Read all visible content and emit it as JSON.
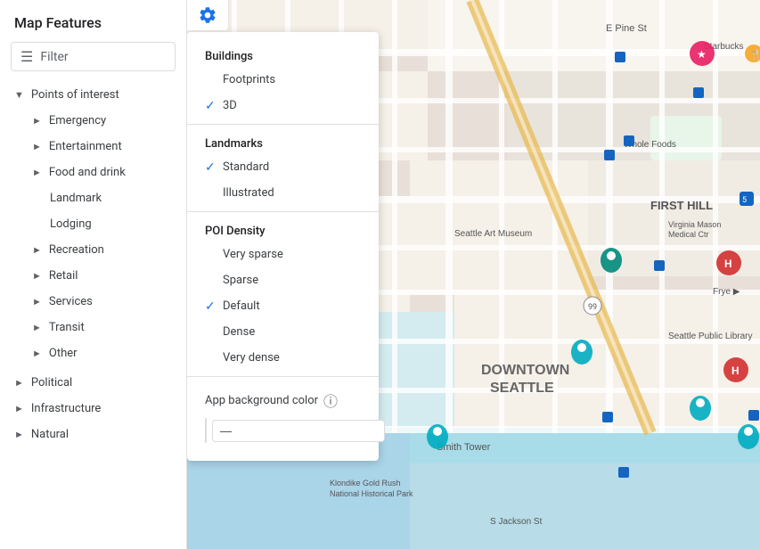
{
  "sidebar": {
    "title": "Map Features",
    "filter_placeholder": "Filter",
    "sections": [
      {
        "label": "Points of interest",
        "type": "section",
        "expanded": true,
        "children": [
          {
            "label": "Emergency",
            "indent": 1
          },
          {
            "label": "Entertainment",
            "indent": 1
          },
          {
            "label": "Food and drink",
            "indent": 1
          },
          {
            "label": "Landmark",
            "indent": 2
          },
          {
            "label": "Lodging",
            "indent": 2
          },
          {
            "label": "Recreation",
            "indent": 1
          },
          {
            "label": "Retail",
            "indent": 1
          },
          {
            "label": "Services",
            "indent": 1
          },
          {
            "label": "Transit",
            "indent": 1
          },
          {
            "label": "Other",
            "indent": 1
          }
        ]
      },
      {
        "label": "Political",
        "indent": 0
      },
      {
        "label": "Infrastructure",
        "indent": 0
      },
      {
        "label": "Natural",
        "indent": 0
      }
    ]
  },
  "dropdown": {
    "buildings_title": "Buildings",
    "footprints_label": "Footprints",
    "three_d_label": "3D",
    "three_d_checked": true,
    "landmarks_title": "Landmarks",
    "standard_label": "Standard",
    "standard_checked": true,
    "illustrated_label": "Illustrated",
    "illustrated_checked": false,
    "poi_density_title": "POI Density",
    "density_options": [
      {
        "label": "Very sparse",
        "checked": false
      },
      {
        "label": "Sparse",
        "checked": false
      },
      {
        "label": "Default",
        "checked": true
      },
      {
        "label": "Dense",
        "checked": false
      },
      {
        "label": "Very dense",
        "checked": false
      }
    ],
    "bg_color_title": "App background color",
    "bg_color_value": "—"
  }
}
